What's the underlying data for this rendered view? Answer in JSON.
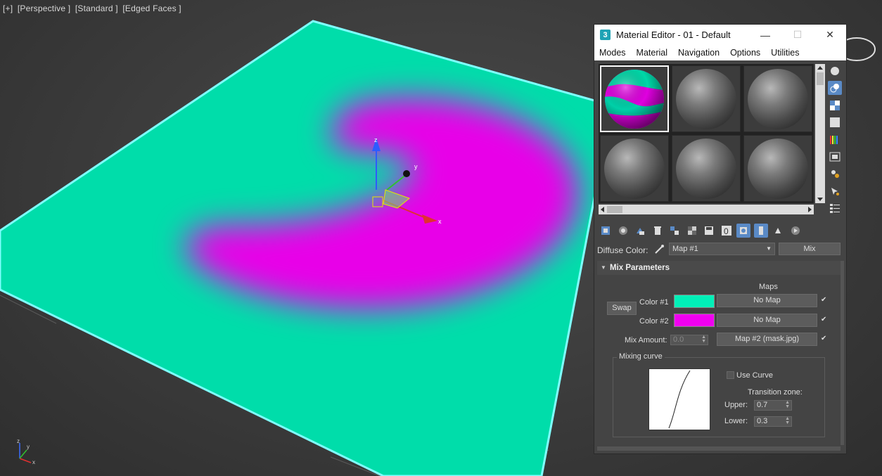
{
  "viewport": {
    "labels": [
      "[+]",
      "[Perspective ]",
      "[Standard ]",
      "[Edged Faces ]"
    ],
    "plane_color": "#00DDAA",
    "blob_color": "#E800E8",
    "gizmo": {
      "axis_x": "x",
      "axis_y": "y",
      "axis_z": "z"
    },
    "corner_axes": {
      "x": "x",
      "y": "y",
      "z": "z"
    }
  },
  "material_editor": {
    "title": "Material Editor - 01 - Default",
    "app_icon": "3",
    "window_buttons": {
      "minimize": "—",
      "maximize": "☐",
      "close": "✕"
    },
    "menu": [
      "Modes",
      "Material",
      "Navigation",
      "Options",
      "Utilities"
    ],
    "slots": [
      "active-mix",
      "gray",
      "gray",
      "gray",
      "gray",
      "gray"
    ],
    "diffuse": {
      "label": "Diffuse Color:",
      "map_value": "Map #1",
      "type_button": "Mix"
    },
    "rollout": {
      "title": "Mix Parameters",
      "toggle": "▼"
    },
    "params": {
      "maps_header": "Maps",
      "swap": "Swap",
      "color1": {
        "label": "Color #1",
        "swatch": "#00F0B8",
        "map": "No Map",
        "checked": "✔"
      },
      "color2": {
        "label": "Color #2",
        "swatch": "#F000F0",
        "map": "No Map",
        "checked": "✔"
      },
      "mix_amount": {
        "label": "Mix Amount:",
        "value": "0.0",
        "map": "Map #2 (mask.jpg)",
        "checked": "✔"
      }
    },
    "mixing_curve": {
      "title": "Mixing curve",
      "use_curve": "Use Curve",
      "transition_zone": "Transition zone:",
      "upper": {
        "label": "Upper:",
        "value": "0.7"
      },
      "lower": {
        "label": "Lower:",
        "value": "0.3"
      }
    }
  }
}
